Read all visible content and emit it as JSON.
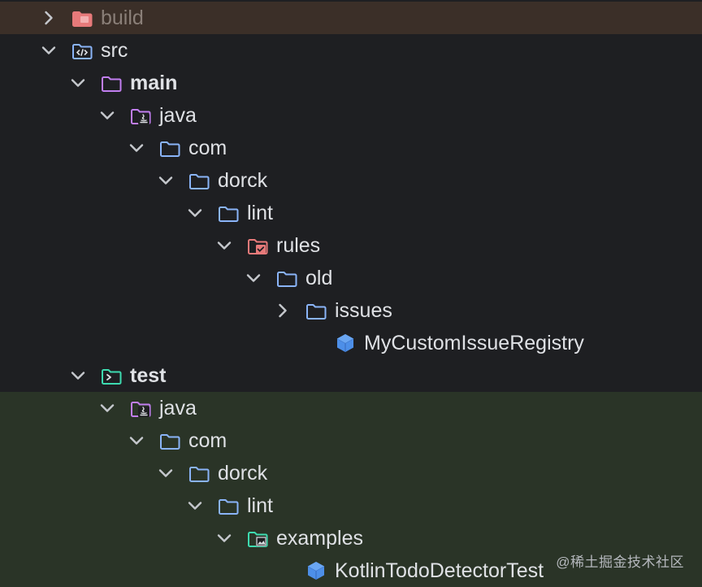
{
  "tree": [
    {
      "label": "build",
      "icon": "excluded-folder-icon",
      "expanded": false
    },
    {
      "label": "src",
      "icon": "source-folder-icon",
      "expanded": true
    },
    {
      "label": "main",
      "icon": "module-folder-icon",
      "expanded": true
    },
    {
      "label": "java",
      "icon": "java-source-folder-icon",
      "expanded": true
    },
    {
      "label": "com",
      "icon": "package-folder-icon",
      "expanded": true
    },
    {
      "label": "dorck",
      "icon": "package-folder-icon",
      "expanded": true
    },
    {
      "label": "lint",
      "icon": "package-folder-icon",
      "expanded": true
    },
    {
      "label": "rules",
      "icon": "rules-folder-icon",
      "expanded": true
    },
    {
      "label": "old",
      "icon": "package-folder-icon",
      "expanded": true
    },
    {
      "label": "issues",
      "icon": "package-folder-icon",
      "expanded": false
    },
    {
      "label": "MyCustomIssueRegistry",
      "icon": "class-icon"
    },
    {
      "label": "test",
      "icon": "test-folder-icon",
      "expanded": true
    },
    {
      "label": "java",
      "icon": "java-source-folder-icon",
      "expanded": true
    },
    {
      "label": "com",
      "icon": "package-folder-icon",
      "expanded": true
    },
    {
      "label": "dorck",
      "icon": "package-folder-icon",
      "expanded": true
    },
    {
      "label": "lint",
      "icon": "package-folder-icon",
      "expanded": true
    },
    {
      "label": "examples",
      "icon": "test-resources-folder-icon",
      "expanded": true
    },
    {
      "label": "KotlinTodoDetectorTest",
      "icon": "class-icon"
    }
  ],
  "watermark": "@稀土掘金技术社区",
  "colors": {
    "background": "#1e1f22",
    "excluded_row": "#3b2f28",
    "test_zone": "#2a3427",
    "folder_blue": "#8ab4f8",
    "module_purple": "#c17ef0",
    "excluded_red": "#e77a7a",
    "test_green": "#3ddbb0",
    "class_blue": "#4d8fe8"
  }
}
